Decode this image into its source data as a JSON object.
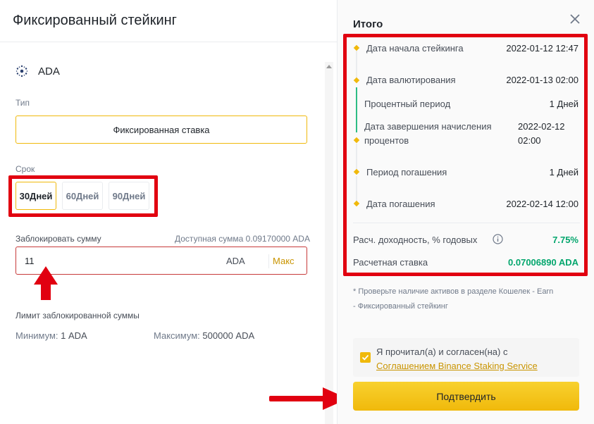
{
  "left": {
    "title": "Фиксированный стейкинг",
    "coin": "ADA",
    "type_label": "Тип",
    "type_value": "Фиксированная ставка",
    "term_label": "Срок",
    "terms": [
      "30Дней",
      "60Дней",
      "90Дней"
    ],
    "lock_label": "Заблокировать сумму",
    "available": "Доступная сумма 0.09170000 ADA",
    "amount_value": "11",
    "amount_unit": "ADA",
    "max_label": "Макс",
    "limit_label": "Лимит заблокированной суммы",
    "min_label": "Минимум:",
    "min_value": "1 ADA",
    "max_limit_label": "Максимум:",
    "max_limit_value": "500000 ADA"
  },
  "summary": {
    "title": "Итого",
    "rows": [
      {
        "label": "Дата начала стейкинга",
        "value": "2022-01-12 12:47"
      },
      {
        "label": "Дата валютирования",
        "value": "2022-01-13 02:00"
      },
      {
        "label": "Процентный период",
        "value": "1 Дней"
      },
      {
        "label_line1": "Дата завершения начисления",
        "label_line2": "процентов",
        "value_line1": "2022-02-12",
        "value_line2": "02:00"
      },
      {
        "label": "Период погашения",
        "value": "1 Дней"
      },
      {
        "label": "Дата погашения",
        "value": "2022-02-14 12:00"
      }
    ],
    "apy_label": "Расч. доходность, % годовых",
    "apy_value": "7.75%",
    "rate_label": "Расчетная ставка",
    "rate_value": "0.07006890 ADA",
    "note_line1": "* Проверьте наличие активов в разделе Кошелек - Earn",
    "note_line2": "- Фиксированный стейкинг",
    "agree_text": "Я прочитал(а) и согласен(на) с",
    "agree_link": "Соглашением Binance Staking Service",
    "confirm": "Подтвердить"
  },
  "colors": {
    "accent": "#f0b90b",
    "highlight": "#e10010",
    "positive": "#03a66d"
  },
  "icons": [
    "cardano-icon",
    "close-icon",
    "info-icon",
    "check-icon",
    "red-arrow-up",
    "red-arrow-right"
  ]
}
